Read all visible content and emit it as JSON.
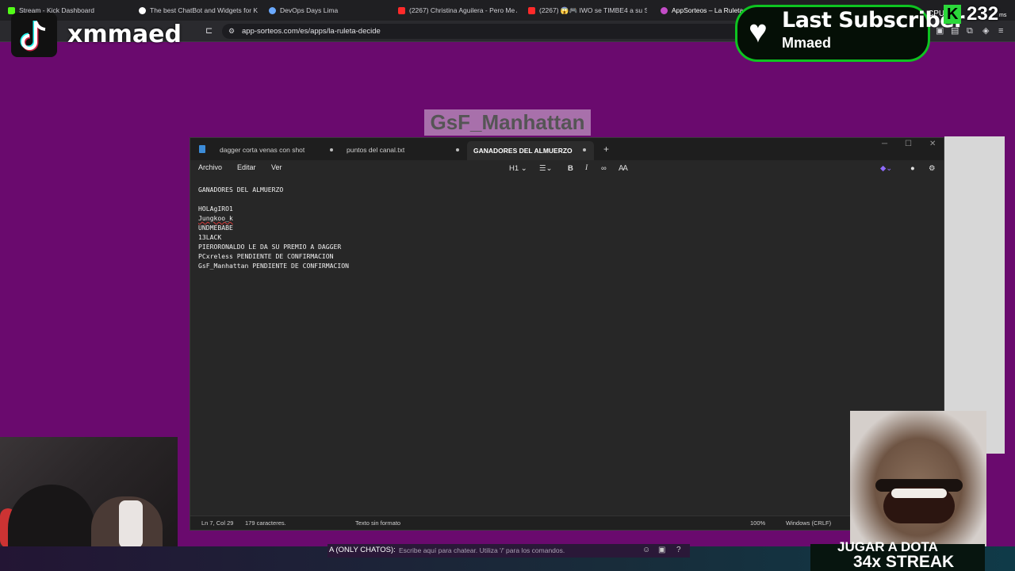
{
  "browser": {
    "tabs": [
      {
        "label": "Stream - Kick Dashboard",
        "color": "#53fc18"
      },
      {
        "label": "The best ChatBot and Widgets for Ki",
        "color": "#ffffff"
      },
      {
        "label": "DevOps Days Lima",
        "color": "#6aa9ff"
      },
      {
        "label": "(2267) Christina Aguilera - Pero Me A",
        "color": "#ff2a2a"
      },
      {
        "label": "(2267) 😱🎮 IWO se TIMBE4 a su SU",
        "color": "#ff2a2a"
      },
      {
        "label": "AppSorteos – La Ruleta de",
        "color": "#c34cc7"
      }
    ],
    "url": "app-sorteos.com/es/apps/la-ruleta-decide"
  },
  "page": {
    "winner_name": "GsF_Manhattan"
  },
  "notepad": {
    "tabs": [
      {
        "label": "dagger corta venas con shot"
      },
      {
        "label": "puntos del canal.txt"
      },
      {
        "label": "GANADORES DEL ALMUERZO"
      }
    ],
    "menu": {
      "file": "Archivo",
      "edit": "Editar",
      "view": "Ver"
    },
    "toolbar": {
      "heading": "H1"
    },
    "lines": [
      "GANADORES DEL ALMUERZO",
      "",
      "HOLAgIRO1",
      "Jungkoo_k",
      "UNDMEBABE",
      "13LACK",
      "PIERORONALDO LE DA SU PREMIO A DAGGER",
      "PCxreless PENDIENTE DE CONFIRMACION",
      "GsF_Manhattan PENDIENTE DE CONFIRMACION"
    ],
    "status": {
      "position": "Ln 7, Col 29",
      "chars": "179 caracteres.",
      "format": "Texto sin formato",
      "zoom": "100%",
      "line_ending": "Windows (CRLF)"
    }
  },
  "overlay": {
    "username": "xmmaed",
    "sub_title": "Last Subscriber",
    "sub_name": "Mmaed",
    "kick_count": "232",
    "cpu_label": "CPU",
    "ms_label": "ms",
    "chat_label": "A (ONLY CHATOS):",
    "chat_placeholder": "Escribe aquí para chatear. Utiliza '/' para los comandos.",
    "banner_line1": "JUGAR A DOTA",
    "banner_line2": "34x STREAK",
    "accent": "#0ec321"
  }
}
